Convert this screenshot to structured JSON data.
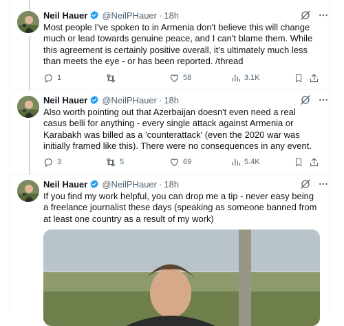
{
  "tweets": [
    {
      "author_name": "Neil Hauer",
      "handle": "@NeilPHauer",
      "separator": "·",
      "time": "18h",
      "text": "Most people I've spoken to in Armenia don't believe this will change much or lead towards genuine peace, and I can't blame them. While this agreement is certainly positive overall, it's ultimately much less than meets the eye - or has been reported. /thread",
      "replies": "1",
      "retweets": "",
      "likes": "58",
      "views": "3.1K"
    },
    {
      "author_name": "Neil Hauer",
      "handle": "@NeilPHauer",
      "separator": "·",
      "time": "18h",
      "text": "Also worth pointing out that Azerbaijan doesn't even need a real casus belli for anything - every single attack against Armenia or Karabakh was billed as a 'counterattack' (even the 2020 war was initially framed like this). There were no consequences in any event.",
      "replies": "3",
      "retweets": "5",
      "likes": "69",
      "views": "5.4K"
    },
    {
      "author_name": "Neil Hauer",
      "handle": "@NeilPHauer",
      "separator": "·",
      "time": "18h",
      "text": "If you find my work helpful, you can drop me a tip - never easy being a freelance journalist these days (speaking as someone banned from at least one country as a result of my work)"
    }
  ],
  "colors": {
    "accent_blue": "#1d9bf0",
    "secondary_text": "#536471",
    "divider": "#eff3f4"
  },
  "icons": [
    "grok-icon",
    "more-icon",
    "reply-icon",
    "retweet-icon",
    "like-icon",
    "views-icon",
    "bookmark-icon",
    "share-icon",
    "verified-badge-icon"
  ]
}
